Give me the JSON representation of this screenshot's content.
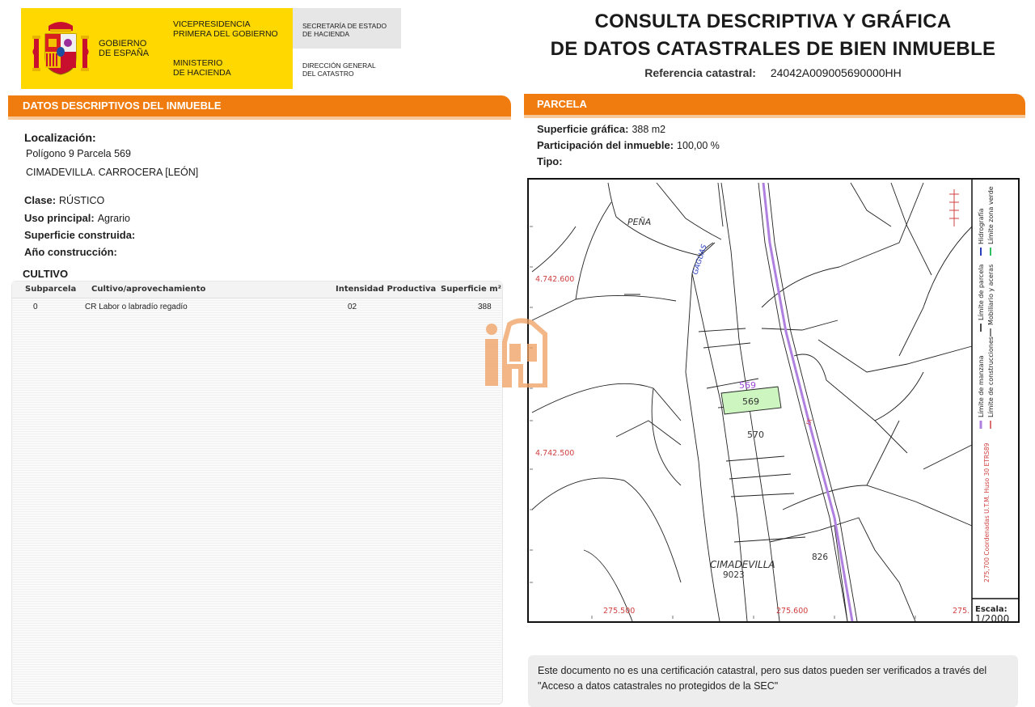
{
  "header": {
    "gov_name": "GOBIERNO\nDE ESPAÑA",
    "vice": "VICEPRESIDENCIA\nPRIMERA DEL GOBIERNO",
    "ministry": "MINISTERIO\nDE HACIENDA",
    "secretaria": "SECRETARÍA DE ESTADO\nDE HACIENDA",
    "direccion": "DIRECCIÓN GENERAL\nDEL CATASTRO",
    "title_line1": "CONSULTA DESCRIPTIVA Y GRÁFICA",
    "title_line2": "DE DATOS CATASTRALES DE BIEN INMUEBLE",
    "ref_label": "Referencia catastral:",
    "ref_value": "24042A009005690000HH",
    "colors": {
      "yellow": "#ffd800",
      "orange": "#f07c10"
    }
  },
  "descriptive": {
    "section_title": "DATOS DESCRIPTIVOS DEL INMUEBLE",
    "location_label": "Localización:",
    "location_line1": "Polígono 9 Parcela 569",
    "location_line2": "CIMADEVILLA. CARROCERA [LEÓN]",
    "clase_label": "Clase:",
    "clase_value": "RÚSTICO",
    "uso_label": "Uso principal:",
    "uso_value": "Agrario",
    "sup_label": "Superficie construida:",
    "anio_label": "Año construcción:",
    "cultivo_label": "CULTIVO",
    "columns": [
      "Subparcela",
      "Cultivo/aprovechamiento",
      "Intensidad Productiva",
      "Superficie m²"
    ],
    "rows": [
      {
        "subparcela": "0",
        "cultivo": "CR Labor o labradío regadío",
        "intensidad": "02",
        "superficie": "388"
      }
    ]
  },
  "parcela": {
    "section_title": "PARCELA",
    "sup_label": "Superficie gráfica:",
    "sup_value": "388 m2",
    "part_label": "Participación del inmueble:",
    "part_value": "100,00 %",
    "tipo_label": "Tipo:"
  },
  "map": {
    "place_pena": "PEÑA",
    "river": "GAGUAS",
    "coord_y1": "4.742.600",
    "coord_y2": "4.742.500",
    "coord_x1": "275.500",
    "coord_x2": "275.600",
    "coord_x3": "275.",
    "parcel_569": "569",
    "parcel_569_label": "569",
    "parcel_570": "570",
    "place_cimadevilla": "CIMADEVILLA",
    "code_9023": "9023",
    "code_826": "826",
    "road_label": "IX",
    "legend": [
      "Límite de manzana",
      "Límite de parcela",
      "Hidrografía",
      "Límite de construcciones",
      "Mobiliario y aceras",
      "Límite zona verde"
    ],
    "utm": "275,700 Coordenadas U.T.M. Huso 30 ETRS89",
    "scale_label": "Escala:",
    "scale_value": "1/2000",
    "colors": {
      "highlight": "#cdf5c0",
      "road": "#b080e0",
      "coords": "#d04040"
    }
  },
  "disclaimer": "Este documento no es una certificación catastral, pero sus datos pueden ser verificados a través del \"Acceso a datos catastrales no protegidos de la SEC\""
}
